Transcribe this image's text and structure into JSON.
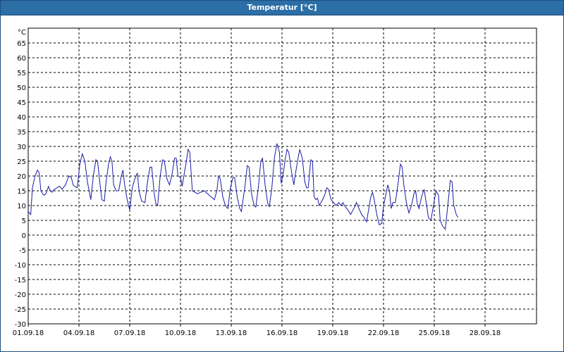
{
  "window": {
    "title": "Temperatur [°C]"
  },
  "colors": {
    "title_bar": "#2c6ea6",
    "series": "#1a1aa6",
    "grid": "#000000"
  },
  "chart_data": {
    "type": "line",
    "title": "Temperatur [°C]",
    "unit_label": "°C",
    "ylim": [
      -30,
      70
    ],
    "yticks": [
      65,
      60,
      55,
      50,
      45,
      40,
      35,
      30,
      25,
      20,
      15,
      10,
      5,
      0,
      -5,
      -10,
      -15,
      -20,
      -25,
      -30
    ],
    "x_range_days": [
      0,
      30.6
    ],
    "xtick_labels": [
      "01.09.18",
      "04.09.18",
      "07.09.18",
      "10.09.18",
      "13.09.18",
      "16.09.18",
      "19.09.18",
      "22.09.18",
      "25.09.18",
      "28.09.18"
    ],
    "grid": true,
    "legend": "none",
    "series": [
      {
        "points": [
          [
            0.0,
            8.0
          ],
          [
            0.15,
            7.0
          ],
          [
            0.25,
            16.0
          ],
          [
            0.4,
            20.0
          ],
          [
            0.55,
            22.0
          ],
          [
            0.65,
            21.0
          ],
          [
            0.75,
            15.0
          ],
          [
            0.85,
            14.0
          ],
          [
            0.95,
            13.5
          ],
          [
            1.05,
            14.0
          ],
          [
            1.2,
            16.5
          ],
          [
            1.3,
            15.0
          ],
          [
            1.4,
            14.5
          ],
          [
            1.55,
            15.5
          ],
          [
            1.7,
            16.0
          ],
          [
            1.85,
            16.5
          ],
          [
            2.0,
            15.5
          ],
          [
            2.2,
            17.0
          ],
          [
            2.4,
            20.0
          ],
          [
            2.55,
            19.5
          ],
          [
            2.65,
            17.0
          ],
          [
            2.75,
            16.5
          ],
          [
            2.9,
            16.0
          ],
          [
            3.05,
            24.0
          ],
          [
            3.2,
            27.5
          ],
          [
            3.35,
            25.0
          ],
          [
            3.5,
            18.0
          ],
          [
            3.7,
            12.0
          ],
          [
            3.85,
            20.0
          ],
          [
            4.0,
            25.5
          ],
          [
            4.1,
            25.0
          ],
          [
            4.25,
            17.0
          ],
          [
            4.35,
            12.0
          ],
          [
            4.5,
            11.5
          ],
          [
            4.6,
            18.0
          ],
          [
            4.75,
            24.0
          ],
          [
            4.85,
            26.5
          ],
          [
            4.95,
            25.0
          ],
          [
            5.05,
            17.0
          ],
          [
            5.2,
            15.0
          ],
          [
            5.35,
            15.0
          ],
          [
            5.5,
            20.0
          ],
          [
            5.6,
            22.0
          ],
          [
            5.7,
            17.0
          ],
          [
            5.85,
            12.0
          ],
          [
            6.0,
            8.5
          ],
          [
            6.15,
            16.0
          ],
          [
            6.3,
            19.0
          ],
          [
            6.45,
            21.0
          ],
          [
            6.55,
            15.0
          ],
          [
            6.7,
            11.5
          ],
          [
            6.9,
            11.0
          ],
          [
            7.05,
            18.0
          ],
          [
            7.2,
            23.0
          ],
          [
            7.3,
            23.0
          ],
          [
            7.45,
            14.0
          ],
          [
            7.55,
            10.5
          ],
          [
            7.65,
            10.0
          ],
          [
            7.8,
            20.0
          ],
          [
            7.95,
            25.5
          ],
          [
            8.05,
            25.0
          ],
          [
            8.2,
            19.0
          ],
          [
            8.35,
            17.0
          ],
          [
            8.5,
            20.5
          ],
          [
            8.65,
            26.0
          ],
          [
            8.75,
            26.0
          ],
          [
            8.85,
            20.0
          ],
          [
            9.0,
            19.5
          ],
          [
            9.1,
            16.5
          ],
          [
            9.2,
            20.0
          ],
          [
            9.35,
            25.0
          ],
          [
            9.45,
            29.0
          ],
          [
            9.55,
            28.0
          ],
          [
            9.7,
            15.0
          ],
          [
            9.85,
            14.5
          ],
          [
            10.0,
            14.0
          ],
          [
            10.2,
            14.5
          ],
          [
            10.4,
            15.0
          ],
          [
            10.6,
            14.0
          ],
          [
            10.8,
            13.0
          ],
          [
            11.0,
            12.0
          ],
          [
            11.15,
            15.0
          ],
          [
            11.25,
            20.0
          ],
          [
            11.35,
            19.0
          ],
          [
            11.5,
            13.0
          ],
          [
            11.65,
            10.0
          ],
          [
            11.8,
            9.0
          ],
          [
            11.95,
            16.0
          ],
          [
            12.1,
            19.5
          ],
          [
            12.2,
            19.5
          ],
          [
            12.35,
            13.0
          ],
          [
            12.5,
            9.0
          ],
          [
            12.6,
            8.0
          ],
          [
            12.8,
            16.0
          ],
          [
            12.95,
            23.5
          ],
          [
            13.05,
            23.0
          ],
          [
            13.2,
            14.0
          ],
          [
            13.35,
            10.0
          ],
          [
            13.45,
            9.5
          ],
          [
            13.6,
            16.0
          ],
          [
            13.75,
            25.0
          ],
          [
            13.85,
            26.0
          ],
          [
            14.0,
            17.0
          ],
          [
            14.15,
            11.0
          ],
          [
            14.25,
            9.5
          ],
          [
            14.4,
            16.0
          ],
          [
            14.55,
            26.0
          ],
          [
            14.7,
            31.0
          ],
          [
            14.85,
            28.0
          ],
          [
            14.95,
            17.5
          ],
          [
            15.05,
            20.0
          ],
          [
            15.2,
            26.0
          ],
          [
            15.3,
            29.0
          ],
          [
            15.4,
            28.0
          ],
          [
            15.55,
            22.0
          ],
          [
            15.7,
            17.0
          ],
          [
            15.8,
            21.0
          ],
          [
            15.95,
            26.0
          ],
          [
            16.05,
            29.0
          ],
          [
            16.2,
            26.0
          ],
          [
            16.35,
            18.0
          ],
          [
            16.45,
            16.0
          ],
          [
            16.55,
            16.0
          ],
          [
            16.7,
            25.5
          ],
          [
            16.8,
            25.0
          ],
          [
            16.9,
            13.0
          ],
          [
            17.0,
            12.0
          ],
          [
            17.1,
            12.5
          ],
          [
            17.2,
            10.0
          ],
          [
            17.4,
            12.0
          ],
          [
            17.55,
            14.0
          ],
          [
            17.65,
            16.0
          ],
          [
            17.75,
            15.5
          ],
          [
            17.9,
            12.0
          ],
          [
            18.05,
            11.0
          ],
          [
            18.2,
            10.0
          ],
          [
            18.35,
            11.0
          ],
          [
            18.5,
            10.0
          ],
          [
            18.6,
            11.0
          ],
          [
            18.75,
            9.5
          ],
          [
            18.9,
            8.5
          ],
          [
            19.05,
            7.0
          ],
          [
            19.25,
            9.0
          ],
          [
            19.4,
            11.0
          ],
          [
            19.55,
            9.0
          ],
          [
            19.7,
            7.0
          ],
          [
            19.85,
            6.0
          ],
          [
            20.0,
            4.5
          ],
          [
            20.1,
            8.0
          ],
          [
            20.25,
            13.0
          ],
          [
            20.35,
            14.5
          ],
          [
            20.45,
            12.0
          ],
          [
            20.6,
            7.0
          ],
          [
            20.75,
            3.5
          ],
          [
            20.9,
            4.0
          ],
          [
            21.0,
            10.0
          ],
          [
            21.15,
            14.0
          ],
          [
            21.25,
            17.0
          ],
          [
            21.35,
            15.0
          ],
          [
            21.45,
            9.0
          ],
          [
            21.55,
            11.0
          ],
          [
            21.7,
            11.0
          ],
          [
            21.85,
            17.0
          ],
          [
            22.0,
            24.0
          ],
          [
            22.1,
            23.0
          ],
          [
            22.2,
            17.0
          ],
          [
            22.35,
            11.0
          ],
          [
            22.5,
            7.5
          ],
          [
            22.65,
            10.0
          ],
          [
            22.8,
            14.0
          ],
          [
            22.9,
            15.0
          ],
          [
            23.0,
            10.5
          ],
          [
            23.1,
            9.0
          ],
          [
            23.25,
            13.0
          ],
          [
            23.4,
            15.5
          ],
          [
            23.55,
            10.0
          ],
          [
            23.65,
            6.0
          ],
          [
            23.8,
            5.0
          ],
          [
            23.95,
            10.0
          ],
          [
            24.1,
            15.0
          ],
          [
            24.25,
            13.5
          ],
          [
            24.35,
            5.0
          ],
          [
            24.5,
            3.0
          ],
          [
            24.65,
            2.0
          ],
          [
            24.8,
            10.0
          ],
          [
            24.95,
            18.5
          ],
          [
            25.05,
            18.0
          ],
          [
            25.15,
            10.0
          ],
          [
            25.3,
            7.0
          ],
          [
            25.4,
            6.0
          ]
        ]
      }
    ]
  }
}
